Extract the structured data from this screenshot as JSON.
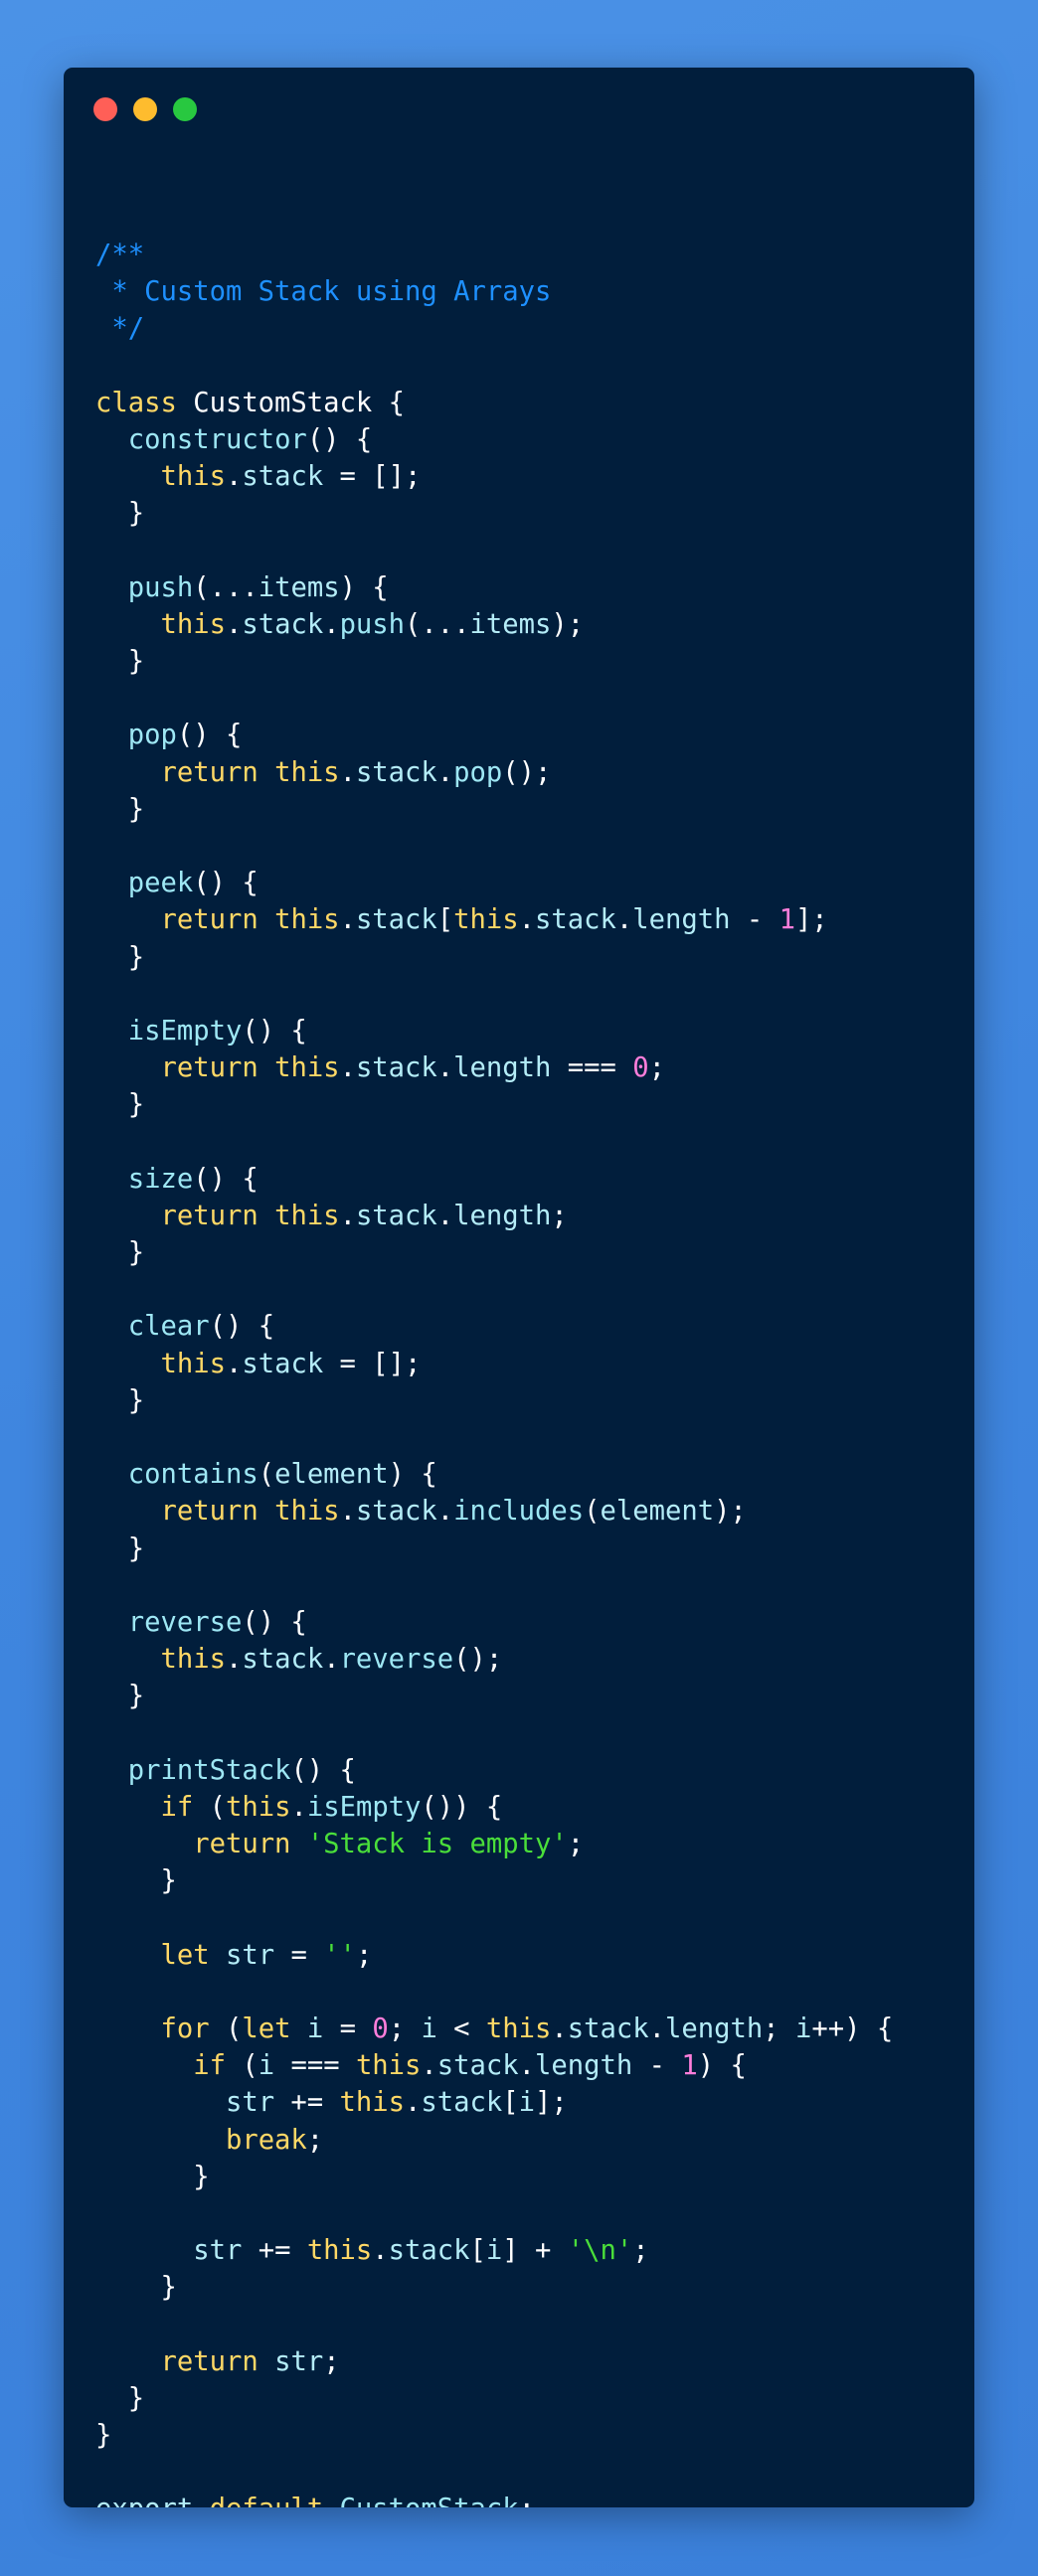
{
  "window": {
    "controls": [
      "close",
      "minimize",
      "maximize"
    ],
    "colors": {
      "background": "#011e3c",
      "close": "#ff5f57",
      "minimize": "#febc2e",
      "maximize": "#28c840",
      "page_background": "#4189e0"
    }
  },
  "code": {
    "language": "javascript",
    "lines": [
      [
        [
          "comment",
          "/**"
        ]
      ],
      [
        [
          "comment",
          " * Custom Stack using Arrays"
        ]
      ],
      [
        [
          "comment",
          " */"
        ]
      ],
      [],
      [
        [
          "keyword",
          "class"
        ],
        [
          "plain",
          " CustomStack {"
        ]
      ],
      [
        [
          "plain",
          "  "
        ],
        [
          "func",
          "constructor"
        ],
        [
          "plain",
          "() {"
        ]
      ],
      [
        [
          "plain",
          "    "
        ],
        [
          "this",
          "this"
        ],
        [
          "plain",
          "."
        ],
        [
          "prop",
          "stack"
        ],
        [
          "plain",
          " = [];"
        ]
      ],
      [
        [
          "plain",
          "  }"
        ]
      ],
      [],
      [
        [
          "plain",
          "  "
        ],
        [
          "func",
          "push"
        ],
        [
          "plain",
          "(..."
        ],
        [
          "prop",
          "items"
        ],
        [
          "plain",
          ") {"
        ]
      ],
      [
        [
          "plain",
          "    "
        ],
        [
          "this",
          "this"
        ],
        [
          "plain",
          "."
        ],
        [
          "prop",
          "stack"
        ],
        [
          "plain",
          "."
        ],
        [
          "func",
          "push"
        ],
        [
          "plain",
          "(..."
        ],
        [
          "prop",
          "items"
        ],
        [
          "plain",
          ");"
        ]
      ],
      [
        [
          "plain",
          "  }"
        ]
      ],
      [],
      [
        [
          "plain",
          "  "
        ],
        [
          "func",
          "pop"
        ],
        [
          "plain",
          "() {"
        ]
      ],
      [
        [
          "plain",
          "    "
        ],
        [
          "keyword",
          "return"
        ],
        [
          "plain",
          " "
        ],
        [
          "this",
          "this"
        ],
        [
          "plain",
          "."
        ],
        [
          "prop",
          "stack"
        ],
        [
          "plain",
          "."
        ],
        [
          "func",
          "pop"
        ],
        [
          "plain",
          "();"
        ]
      ],
      [
        [
          "plain",
          "  }"
        ]
      ],
      [],
      [
        [
          "plain",
          "  "
        ],
        [
          "func",
          "peek"
        ],
        [
          "plain",
          "() {"
        ]
      ],
      [
        [
          "plain",
          "    "
        ],
        [
          "keyword",
          "return"
        ],
        [
          "plain",
          " "
        ],
        [
          "this",
          "this"
        ],
        [
          "plain",
          "."
        ],
        [
          "prop",
          "stack"
        ],
        [
          "plain",
          "["
        ],
        [
          "this",
          "this"
        ],
        [
          "plain",
          "."
        ],
        [
          "prop",
          "stack"
        ],
        [
          "plain",
          "."
        ],
        [
          "prop",
          "length"
        ],
        [
          "plain",
          " - "
        ],
        [
          "num",
          "1"
        ],
        [
          "plain",
          "];"
        ]
      ],
      [
        [
          "plain",
          "  }"
        ]
      ],
      [],
      [
        [
          "plain",
          "  "
        ],
        [
          "func",
          "isEmpty"
        ],
        [
          "plain",
          "() {"
        ]
      ],
      [
        [
          "plain",
          "    "
        ],
        [
          "keyword",
          "return"
        ],
        [
          "plain",
          " "
        ],
        [
          "this",
          "this"
        ],
        [
          "plain",
          "."
        ],
        [
          "prop",
          "stack"
        ],
        [
          "plain",
          "."
        ],
        [
          "prop",
          "length"
        ],
        [
          "plain",
          " === "
        ],
        [
          "num",
          "0"
        ],
        [
          "plain",
          ";"
        ]
      ],
      [
        [
          "plain",
          "  }"
        ]
      ],
      [],
      [
        [
          "plain",
          "  "
        ],
        [
          "func",
          "size"
        ],
        [
          "plain",
          "() {"
        ]
      ],
      [
        [
          "plain",
          "    "
        ],
        [
          "keyword",
          "return"
        ],
        [
          "plain",
          " "
        ],
        [
          "this",
          "this"
        ],
        [
          "plain",
          "."
        ],
        [
          "prop",
          "stack"
        ],
        [
          "plain",
          "."
        ],
        [
          "prop",
          "length"
        ],
        [
          "plain",
          ";"
        ]
      ],
      [
        [
          "plain",
          "  }"
        ]
      ],
      [],
      [
        [
          "plain",
          "  "
        ],
        [
          "func",
          "clear"
        ],
        [
          "plain",
          "() {"
        ]
      ],
      [
        [
          "plain",
          "    "
        ],
        [
          "this",
          "this"
        ],
        [
          "plain",
          "."
        ],
        [
          "prop",
          "stack"
        ],
        [
          "plain",
          " = [];"
        ]
      ],
      [
        [
          "plain",
          "  }"
        ]
      ],
      [],
      [
        [
          "plain",
          "  "
        ],
        [
          "func",
          "contains"
        ],
        [
          "plain",
          "("
        ],
        [
          "prop",
          "element"
        ],
        [
          "plain",
          ") {"
        ]
      ],
      [
        [
          "plain",
          "    "
        ],
        [
          "keyword",
          "return"
        ],
        [
          "plain",
          " "
        ],
        [
          "this",
          "this"
        ],
        [
          "plain",
          "."
        ],
        [
          "prop",
          "stack"
        ],
        [
          "plain",
          "."
        ],
        [
          "func",
          "includes"
        ],
        [
          "plain",
          "("
        ],
        [
          "prop",
          "element"
        ],
        [
          "plain",
          ");"
        ]
      ],
      [
        [
          "plain",
          "  }"
        ]
      ],
      [],
      [
        [
          "plain",
          "  "
        ],
        [
          "func",
          "reverse"
        ],
        [
          "plain",
          "() {"
        ]
      ],
      [
        [
          "plain",
          "    "
        ],
        [
          "this",
          "this"
        ],
        [
          "plain",
          "."
        ],
        [
          "prop",
          "stack"
        ],
        [
          "plain",
          "."
        ],
        [
          "func",
          "reverse"
        ],
        [
          "plain",
          "();"
        ]
      ],
      [
        [
          "plain",
          "  }"
        ]
      ],
      [],
      [
        [
          "plain",
          "  "
        ],
        [
          "func",
          "printStack"
        ],
        [
          "plain",
          "() {"
        ]
      ],
      [
        [
          "plain",
          "    "
        ],
        [
          "keyword",
          "if"
        ],
        [
          "plain",
          " ("
        ],
        [
          "this",
          "this"
        ],
        [
          "plain",
          "."
        ],
        [
          "func",
          "isEmpty"
        ],
        [
          "plain",
          "()) {"
        ]
      ],
      [
        [
          "plain",
          "      "
        ],
        [
          "keyword",
          "return"
        ],
        [
          "plain",
          " "
        ],
        [
          "str",
          "'Stack is empty'"
        ],
        [
          "plain",
          ";"
        ]
      ],
      [
        [
          "plain",
          "    }"
        ]
      ],
      [],
      [
        [
          "plain",
          "    "
        ],
        [
          "keyword",
          "let"
        ],
        [
          "plain",
          " "
        ],
        [
          "prop",
          "str"
        ],
        [
          "plain",
          " = "
        ],
        [
          "str",
          "''"
        ],
        [
          "plain",
          ";"
        ]
      ],
      [],
      [
        [
          "plain",
          "    "
        ],
        [
          "keyword",
          "for"
        ],
        [
          "plain",
          " ("
        ],
        [
          "keyword",
          "let"
        ],
        [
          "plain",
          " "
        ],
        [
          "prop",
          "i"
        ],
        [
          "plain",
          " = "
        ],
        [
          "num",
          "0"
        ],
        [
          "plain",
          "; "
        ],
        [
          "prop",
          "i"
        ],
        [
          "plain",
          " < "
        ],
        [
          "this",
          "this"
        ],
        [
          "plain",
          "."
        ],
        [
          "prop",
          "stack"
        ],
        [
          "plain",
          "."
        ],
        [
          "prop",
          "length"
        ],
        [
          "plain",
          "; "
        ],
        [
          "prop",
          "i"
        ],
        [
          "plain",
          "++) {"
        ]
      ],
      [
        [
          "plain",
          "      "
        ],
        [
          "keyword",
          "if"
        ],
        [
          "plain",
          " ("
        ],
        [
          "prop",
          "i"
        ],
        [
          "plain",
          " === "
        ],
        [
          "this",
          "this"
        ],
        [
          "plain",
          "."
        ],
        [
          "prop",
          "stack"
        ],
        [
          "plain",
          "."
        ],
        [
          "prop",
          "length"
        ],
        [
          "plain",
          " - "
        ],
        [
          "num",
          "1"
        ],
        [
          "plain",
          ") {"
        ]
      ],
      [
        [
          "plain",
          "        "
        ],
        [
          "prop",
          "str"
        ],
        [
          "plain",
          " += "
        ],
        [
          "this",
          "this"
        ],
        [
          "plain",
          "."
        ],
        [
          "prop",
          "stack"
        ],
        [
          "plain",
          "["
        ],
        [
          "prop",
          "i"
        ],
        [
          "plain",
          "];"
        ]
      ],
      [
        [
          "plain",
          "        "
        ],
        [
          "keyword",
          "break"
        ],
        [
          "plain",
          ";"
        ]
      ],
      [
        [
          "plain",
          "      }"
        ]
      ],
      [],
      [
        [
          "plain",
          "      "
        ],
        [
          "prop",
          "str"
        ],
        [
          "plain",
          " += "
        ],
        [
          "this",
          "this"
        ],
        [
          "plain",
          "."
        ],
        [
          "prop",
          "stack"
        ],
        [
          "plain",
          "["
        ],
        [
          "prop",
          "i"
        ],
        [
          "plain",
          "] + "
        ],
        [
          "str",
          "'\\n'"
        ],
        [
          "plain",
          ";"
        ]
      ],
      [
        [
          "plain",
          "    }"
        ]
      ],
      [],
      [
        [
          "plain",
          "    "
        ],
        [
          "keyword",
          "return"
        ],
        [
          "plain",
          " "
        ],
        [
          "prop",
          "str"
        ],
        [
          "plain",
          ";"
        ]
      ],
      [
        [
          "plain",
          "  }"
        ]
      ],
      [
        [
          "plain",
          "}"
        ]
      ],
      [],
      [
        [
          "prop",
          "export"
        ],
        [
          "plain",
          " "
        ],
        [
          "keyword",
          "default"
        ],
        [
          "plain",
          " "
        ],
        [
          "func",
          "CustomStack"
        ],
        [
          "plain",
          ";"
        ]
      ]
    ]
  }
}
